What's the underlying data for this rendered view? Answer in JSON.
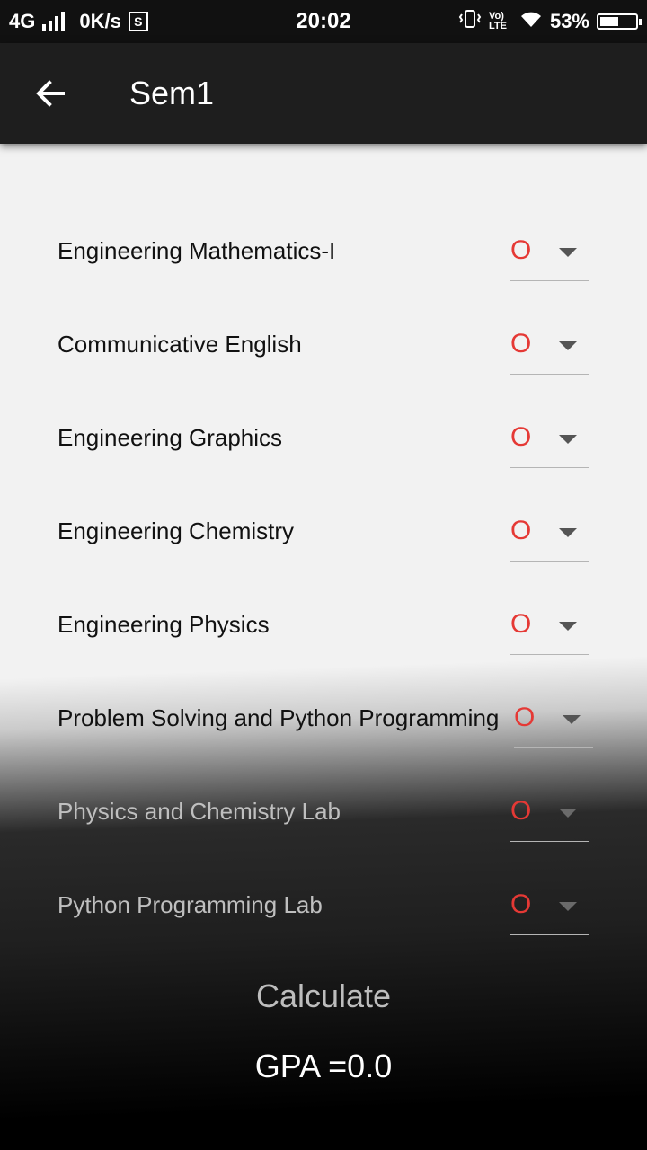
{
  "status_bar": {
    "network": "4G",
    "speed": "0K/s",
    "sim_label": "S",
    "time": "20:02",
    "volte": "Vo) LTE",
    "battery": "53%",
    "battery_level": 0.53
  },
  "appbar": {
    "title": "Sem1"
  },
  "subjects": [
    {
      "name": "Engineering Mathematics-I",
      "grade": "O"
    },
    {
      "name": "Communicative English",
      "grade": "O"
    },
    {
      "name": "Engineering Graphics",
      "grade": "O"
    },
    {
      "name": "Engineering Chemistry",
      "grade": "O"
    },
    {
      "name": "Engineering Physics",
      "grade": "O"
    },
    {
      "name": "Problem Solving and Python Programming",
      "grade": "O"
    },
    {
      "name": "Physics and Chemistry Lab",
      "grade": "O"
    },
    {
      "name": "Python Programming Lab",
      "grade": "O"
    }
  ],
  "actions": {
    "calculate_label": "Calculate",
    "gpa_text": "GPA =0.0"
  },
  "colors": {
    "grade_accent": "#e53935",
    "appbar_bg": "#1e1e1e"
  }
}
